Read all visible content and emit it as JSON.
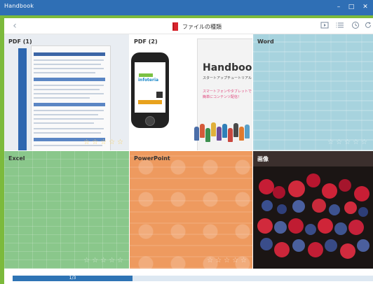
{
  "window": {
    "title": "Handbook",
    "controls": [
      "–",
      "□",
      "✕"
    ]
  },
  "header": {
    "back_icon": "chevron-left-icon",
    "title": "ファイルの種類",
    "tools": [
      "play-icon",
      "list-icon",
      "clock-icon",
      "refresh-icon"
    ]
  },
  "tiles": [
    {
      "label": "PDF (1)"
    },
    {
      "label": "PDF (2)"
    },
    {
      "label": "Word"
    },
    {
      "label": "Excel"
    },
    {
      "label": "PowerPoint"
    },
    {
      "label": "画像"
    }
  ],
  "pdf2": {
    "brand": "infoteria",
    "slide_title": "Handbook",
    "slide_sub": "スタートアップチュートリアル",
    "slide_pink_1": "スマートフォンやタブレットで",
    "slide_pink_2": "簡単にコンテンツ配信！"
  },
  "progress": {
    "text": "1/3",
    "fraction": 0.3333,
    "color": "#2e74b5"
  },
  "colors": {
    "titlebar": "#2f6fb5",
    "accent_frame": "#7cba3c",
    "word": "#a7d3de",
    "excel": "#8ac78b",
    "powerpoint": "#ee9a5f"
  }
}
